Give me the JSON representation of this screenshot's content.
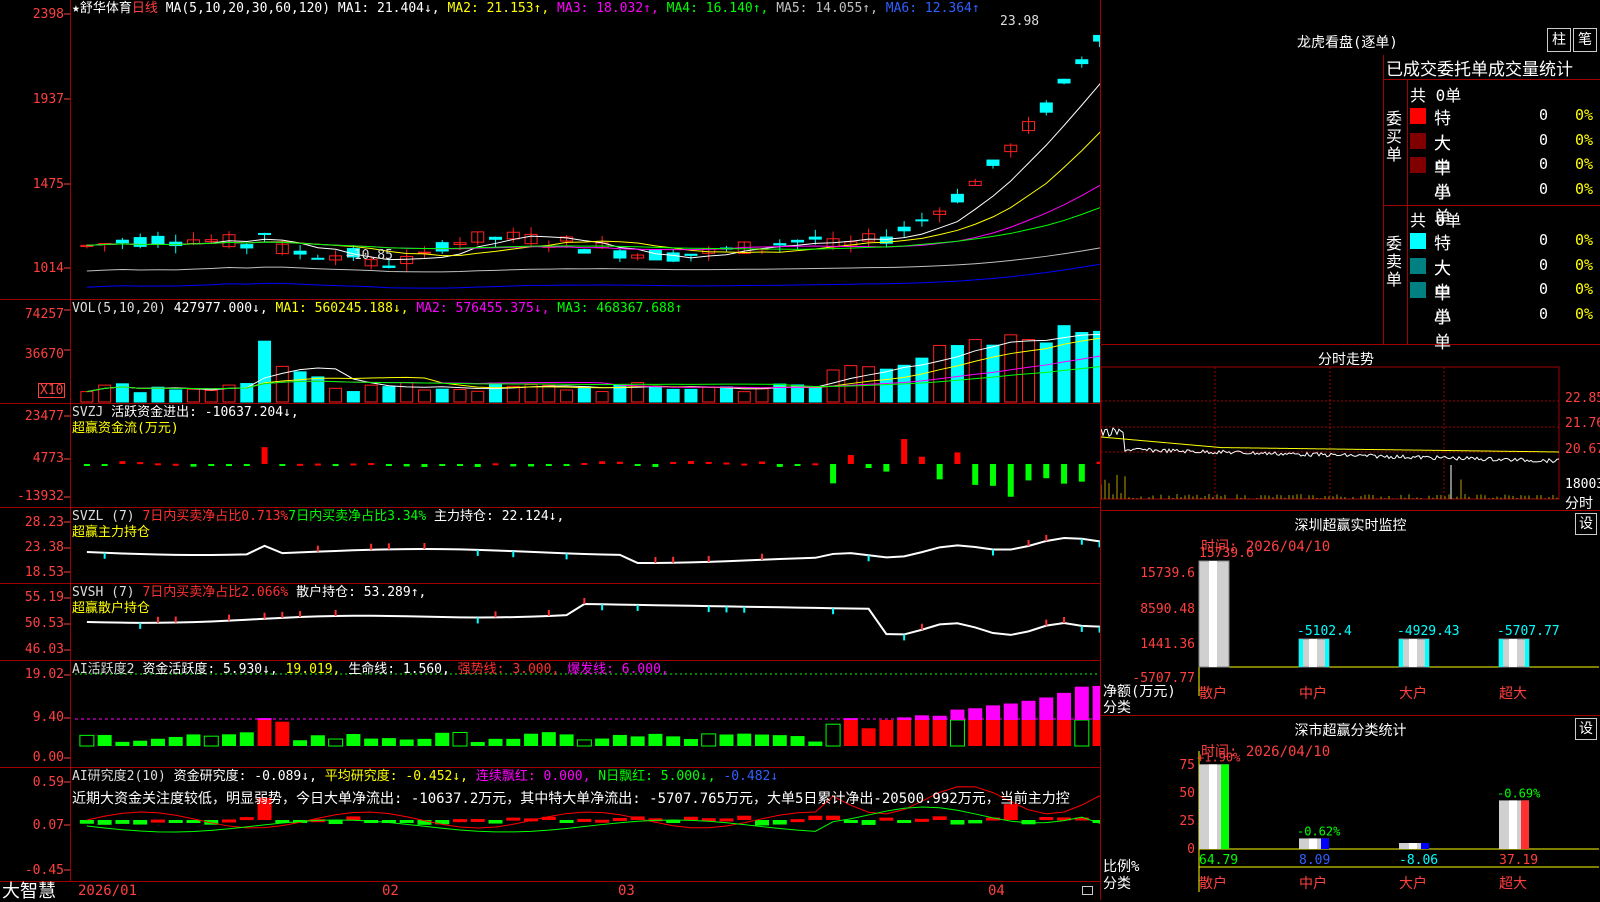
{
  "colors": {
    "up": "#ff2020",
    "down": "#00ffff",
    "flow_pos": "#ff0000",
    "flow_neg": "#00ff00",
    "ma1": "#ffffff",
    "ma2": "#ffff00",
    "ma3": "#ff00ff",
    "ma4": "#00ff00",
    "ma5": "#c0c0c0",
    "ma6": "#0000ff",
    "grid": "#a00000"
  },
  "main": {
    "star": "★",
    "stock_name": "舒华体育",
    "period": "日线",
    "ma_params": "MA(5,10,20,30,60,120)",
    "ma1": "MA1: 21.404↓,",
    "ma2": "MA2: 21.153↑,",
    "ma3": "MA3: 18.032↑,",
    "ma4": "MA4: 16.140↑,",
    "ma5": "MA5: 14.055↑,",
    "ma6": "MA6: 12.364↑",
    "high_label": "23.98",
    "low_label": "←10.85",
    "y_labels": [
      "2398",
      "1937",
      "1475",
      "1014"
    ]
  },
  "vol": {
    "title": "VOL(5,10,20)",
    "value": "427977.000↓,",
    "ma1": "MA1: 560245.188↓,",
    "ma2": "MA2: 576455.375↓,",
    "ma3": "MA3: 468367.688↑",
    "y_labels": [
      "74257",
      "36670"
    ],
    "unit": "X10"
  },
  "svzj": {
    "title": "SVZJ",
    "desc": "活跃资金进出: -10637.204↓,",
    "sub": "超赢资金流(万元)",
    "y_labels": [
      "23477",
      "4773",
      "-13932"
    ]
  },
  "svzl": {
    "title": "SVZL (7)",
    "p1": "7日内买卖净占比0.713%",
    "p2": "7日内买卖净占比3.34%",
    "p3": "主力持仓: 22.124↓,",
    "sub": "超赢主力持仓",
    "y_labels": [
      "28.23",
      "23.38",
      "18.53"
    ]
  },
  "svsh": {
    "title": "SVSH (7)",
    "p1": "7日内买卖净占比2.066%",
    "p2": "散户持仓: 53.289↑,",
    "sub": "超赢散户持仓",
    "y_labels": [
      "55.19",
      "50.53",
      "46.03"
    ]
  },
  "ai1": {
    "title": "AI活跃度2",
    "p1": "资金活跃度: 5.930↓,",
    "p2": "19.019,",
    "p3": "生命线: 1.560,",
    "p4": "强势线: 3.000,",
    "p5": "爆发线: 6.000,",
    "y_labels": [
      "19.02",
      "9.40",
      "0.00"
    ]
  },
  "ai2": {
    "title": "AI研究度2(10)",
    "p1": "资金研究度: -0.089↓,",
    "p2": "平均研究度: -0.452↓,",
    "p3": "连续飘红: 0.000,",
    "p4": "N日飘红: 5.000↓,",
    "p5": "-0.482↓",
    "comment": "近期大资金关注度较低，明显弱势，今日大单净流出: -10637.2万元，其中特大单净流出: -5707.765万元，大单5日累计净出-20500.992万元，当前主力控",
    "y_labels": [
      "0.59",
      "0.07",
      "-0.45"
    ]
  },
  "x_labels": [
    "2026/01",
    "02",
    "03",
    "04"
  ],
  "brand": "大智慧",
  "longhu": {
    "title": "龙虎看盘(逐单)",
    "btn_column": "柱",
    "btn_stroke": "笔",
    "tabs": "已成交委托单成交量统计",
    "buy": {
      "side": "委买单",
      "total": "共 0单",
      "rows": [
        {
          "name": "特大",
          "count": "0",
          "pct": "0%"
        },
        {
          "name": "大单",
          "count": "0",
          "pct": "0%"
        },
        {
          "name": "中单",
          "count": "0",
          "pct": "0%"
        },
        {
          "name": "小单",
          "count": "0",
          "pct": "0%"
        }
      ]
    },
    "sell": {
      "side": "委卖单",
      "total": "共 0单",
      "rows": [
        {
          "name": "特大",
          "count": "0",
          "pct": "0%"
        },
        {
          "name": "大单",
          "count": "0",
          "pct": "0%"
        },
        {
          "name": "中单",
          "count": "0",
          "pct": "0%"
        },
        {
          "name": "小单",
          "count": "0",
          "pct": "0%"
        }
      ]
    }
  },
  "intraday": {
    "title": "分时走势",
    "y_labels": [
      "22.85",
      "21.76",
      "20.67",
      "18003"
    ],
    "bottom": "分时"
  },
  "szmonitor": {
    "title": "深圳超赢实时监控",
    "settings": "设",
    "time": "时间: 2026/04/10",
    "left_label1": "净额(万元)",
    "left_label2": "分类",
    "y_labels": [
      "15739.6",
      "8590.48",
      "1441.36",
      "-5707.77"
    ],
    "bars": [
      {
        "cat": "散户",
        "value": 15739.6,
        "label": "15739.6"
      },
      {
        "cat": "中户",
        "value": -5102.4,
        "label": "-5102.4"
      },
      {
        "cat": "大户",
        "value": -4929.43,
        "label": "-4929.43"
      },
      {
        "cat": "超大",
        "value": -5707.77,
        "label": "-5707.77"
      }
    ]
  },
  "szstat": {
    "title": "深市超赢分类统计",
    "settings": "设",
    "time": "时间: 2026/04/10",
    "left_label1": "比例%",
    "left_label2": "分类",
    "y_labels": [
      "75",
      "50",
      "25",
      "0"
    ],
    "bars": [
      {
        "cat": "散户",
        "value": 64.79,
        "label": "64.79",
        "top": "+1.90%"
      },
      {
        "cat": "中户",
        "value": 8.09,
        "label": "8.09",
        "top": "-0.62%"
      },
      {
        "cat": "大户",
        "value": -8.06,
        "label": "-8.06",
        "top": ""
      },
      {
        "cat": "超大",
        "value": 37.19,
        "label": "37.19",
        "top": "-0.69%"
      }
    ]
  }
}
